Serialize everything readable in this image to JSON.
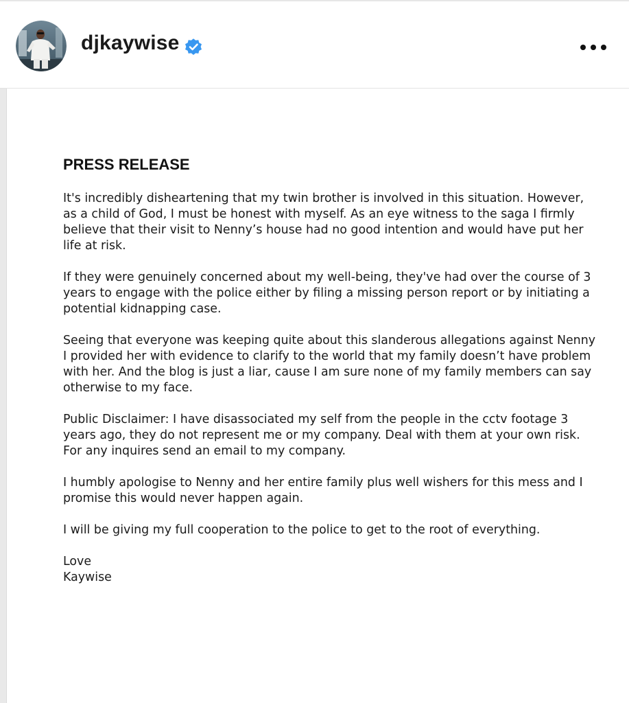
{
  "header": {
    "username": "djkaywise",
    "verified": true,
    "avatar_icon": "profile-photo-avatar",
    "verified_icon": "verified-badge-icon",
    "more_icon": "more-options-icon",
    "accent_color": "#3897f0"
  },
  "post": {
    "title": "PRESS RELEASE",
    "paragraphs": [
      "It's incredibly disheartening that my twin brother is involved in this situation. However, as a child of God, I must be honest with myself. As an eye witness to the saga I firmly believe that their visit to Nenny’s house had no good intention and would have put her life at risk.",
      "If they were genuinely concerned about my well-being, they've had over the course of 3 years to engage with the police either by filing a missing person report or by initiating a potential kidnapping case.",
      "Seeing that everyone was keeping quite about this slanderous allegations against Nenny I provided her with evidence to clarify to the world that my family doesn’t have problem with her. And the blog is just a liar, cause I am sure none of my family members can say otherwise to my face.",
      "Public Disclaimer: I have disassociated my self from the people in the cctv footage 3 years ago, they do not represent me or my company. Deal with them at your own risk. For any inquires send an email to my company.",
      "I humbly apologise to Nenny and her entire family plus well wishers for this mess and I promise this would never happen again.",
      "I will be giving my full cooperation to the police to get to the root of everything."
    ],
    "signoff": "Love",
    "signature": "Kaywise"
  }
}
